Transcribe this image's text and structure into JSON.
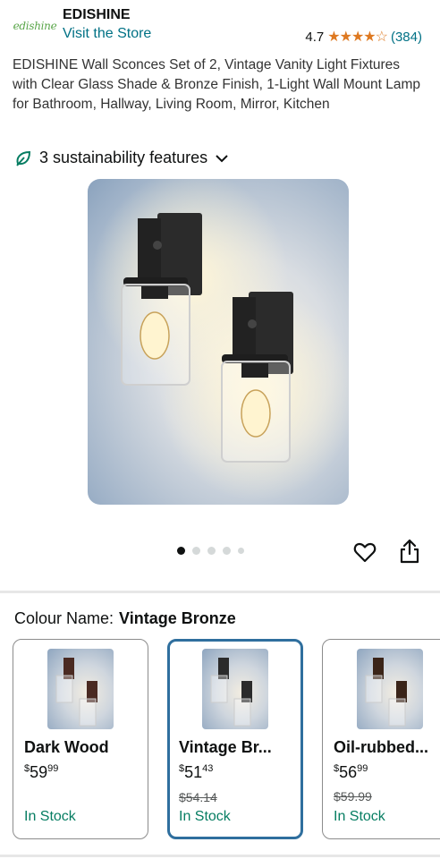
{
  "store": {
    "logo_text": "edishine",
    "brand": "EDISHINE",
    "visit_link": "Visit the Store",
    "rating": "4.7",
    "stars": "★★★★☆",
    "review_count": "(384)"
  },
  "product": {
    "title": "EDISHINE Wall Sconces Set of 2, Vintage Vanity Light Fixtures with Clear Glass Shade & Bronze Finish, 1-Light Wall Mount Lamp for Bathroom, Hallway, Living Room, Mirror, Kitchen",
    "sustainability": "3 sustainability features",
    "image_count": 5,
    "active_image": 1
  },
  "colour": {
    "label": "Colour Name:",
    "selected": "Vintage Bronze",
    "options": [
      {
        "name": "Dark Wood",
        "price_whole": "59",
        "price_frac": "99",
        "was": "",
        "stock": "In Stock"
      },
      {
        "name": "Vintage Br...",
        "price_whole": "51",
        "price_frac": "43",
        "was": "$54.14",
        "stock": "In Stock"
      },
      {
        "name": "Oil-rubbed...",
        "price_whole": "56",
        "price_frac": "99",
        "was": "$59.99",
        "stock": "In Stock"
      }
    ]
  },
  "colors": {
    "link": "#007185",
    "star": "#de7921",
    "stock": "#067d62",
    "selected_border": "#2f6f9e"
  }
}
